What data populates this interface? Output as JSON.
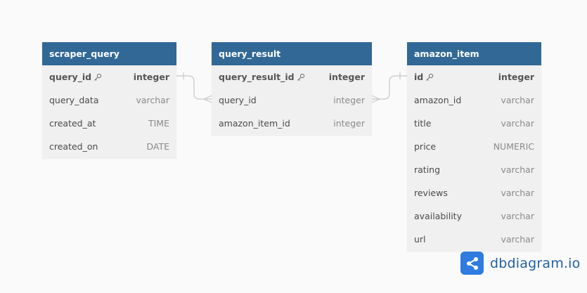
{
  "tables": [
    {
      "name": "scraper_query",
      "fields": [
        {
          "name": "query_id",
          "type": "integer",
          "pk": true
        },
        {
          "name": "query_data",
          "type": "varchar",
          "pk": false
        },
        {
          "name": "created_at",
          "type": "TIME",
          "pk": false
        },
        {
          "name": "created_on",
          "type": "DATE",
          "pk": false
        }
      ]
    },
    {
      "name": "query_result",
      "fields": [
        {
          "name": "query_result_id",
          "type": "integer",
          "pk": true
        },
        {
          "name": "query_id",
          "type": "integer",
          "pk": false
        },
        {
          "name": "amazon_item_id",
          "type": "integer",
          "pk": false
        }
      ]
    },
    {
      "name": "amazon_item",
      "fields": [
        {
          "name": "id",
          "type": "integer",
          "pk": true
        },
        {
          "name": "amazon_id",
          "type": "varchar",
          "pk": false
        },
        {
          "name": "title",
          "type": "varchar",
          "pk": false
        },
        {
          "name": "price",
          "type": "NUMERIC",
          "pk": false
        },
        {
          "name": "rating",
          "type": "varchar",
          "pk": false
        },
        {
          "name": "reviews",
          "type": "varchar",
          "pk": false
        },
        {
          "name": "availability",
          "type": "varchar",
          "pk": false
        },
        {
          "name": "url",
          "type": "varchar",
          "pk": false
        }
      ]
    }
  ],
  "relationships": [
    {
      "from": "scraper_query.query_id",
      "to": "query_result.query_id",
      "type": "one-to-many"
    },
    {
      "from": "amazon_item.id",
      "to": "query_result.query_id",
      "type": "one-to-many"
    }
  ],
  "brand": {
    "text": "dbdiagram.io",
    "logo_icon": "share-nodes-icon",
    "color": "#2f7be0"
  },
  "colors": {
    "header": "#316896",
    "body": "#f0f0f0",
    "connector": "#c8c8c8"
  }
}
